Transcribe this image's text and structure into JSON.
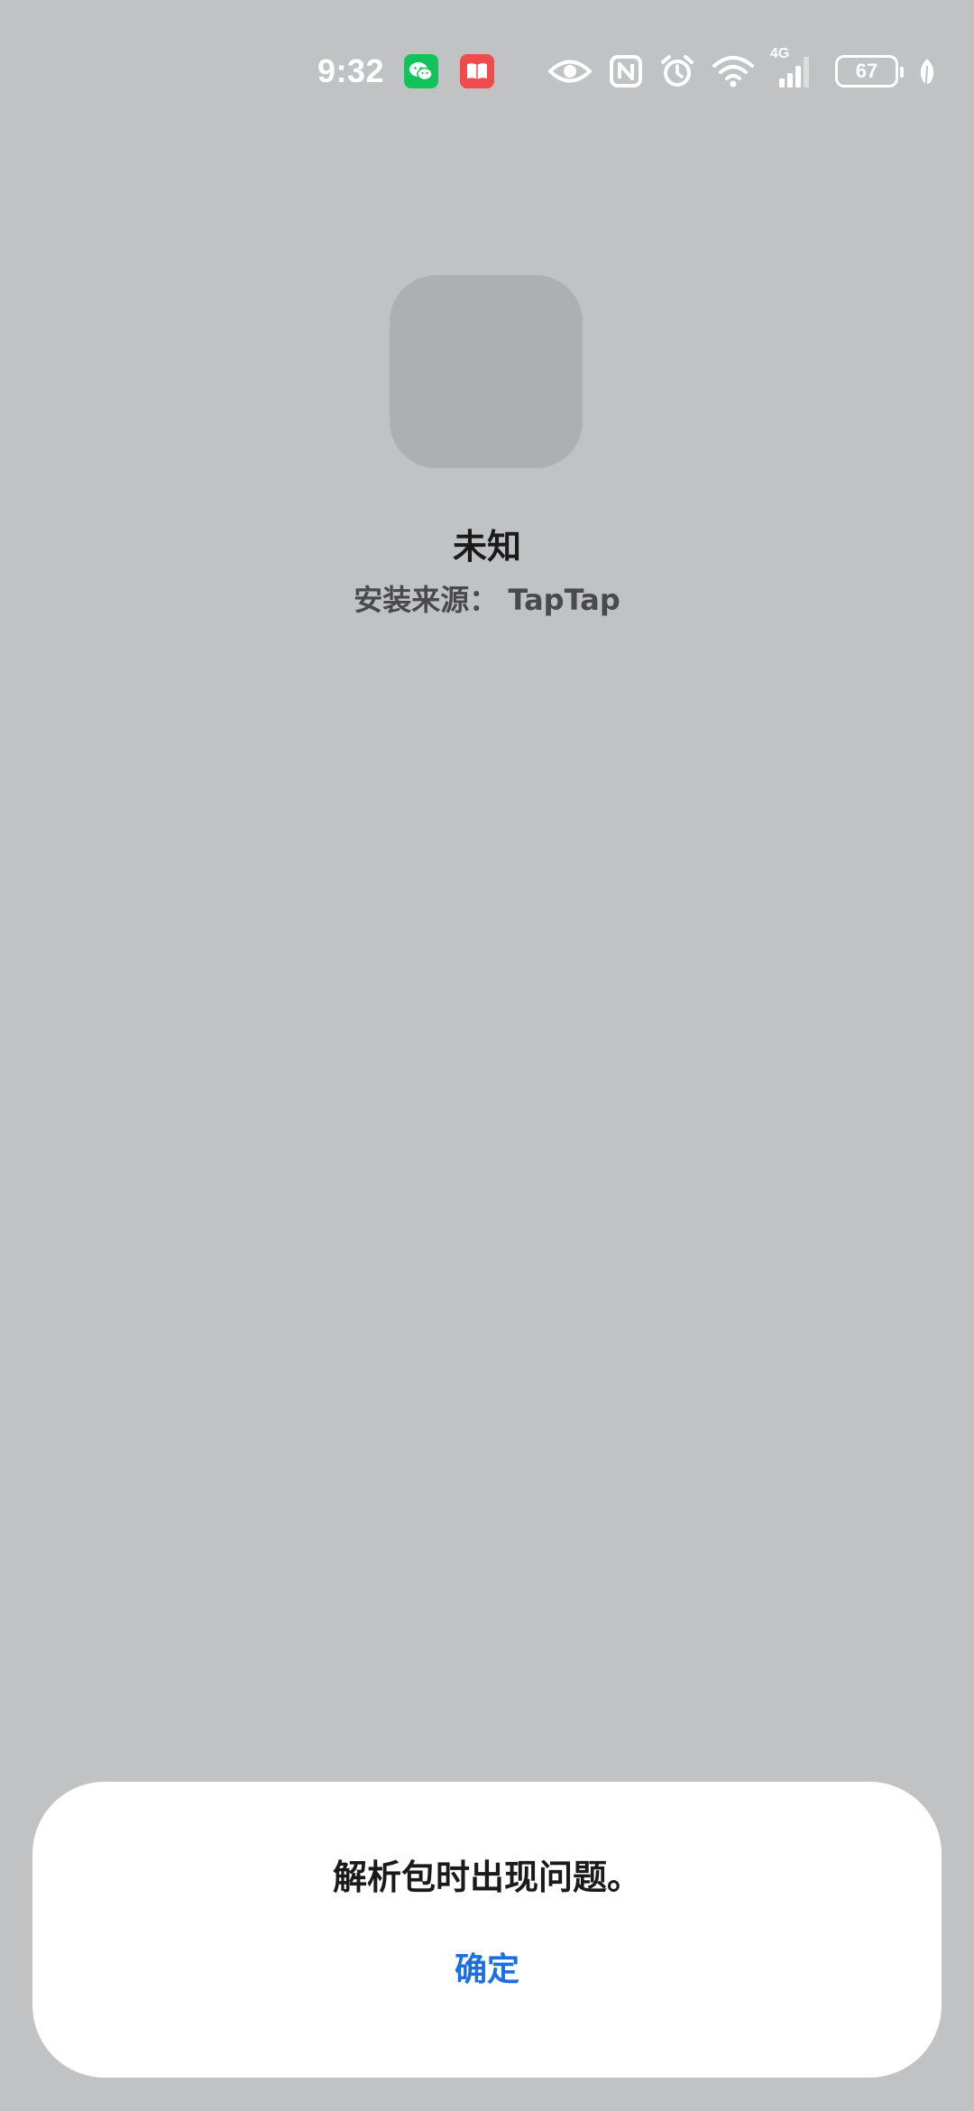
{
  "status_bar": {
    "time": "9:32",
    "notification_icons": [
      "wechat-icon",
      "reader-app-icon"
    ],
    "system_icons": [
      "eye-icon",
      "nfc-icon",
      "alarm-icon",
      "wifi-icon",
      "cellular-signal-icon",
      "battery-icon",
      "leaf-icon"
    ],
    "network_type": "4G",
    "battery_level": "67",
    "colors": {
      "wechat": "#12c35b",
      "reader_app": "#f04a4f"
    }
  },
  "app_info": {
    "name": "未知",
    "install_source_label": "安装来源：",
    "install_source_value": "TapTap"
  },
  "dialog": {
    "message": "解析包时出现问题。",
    "confirm_label": "确定",
    "accent_color": "#1d6fe0"
  }
}
